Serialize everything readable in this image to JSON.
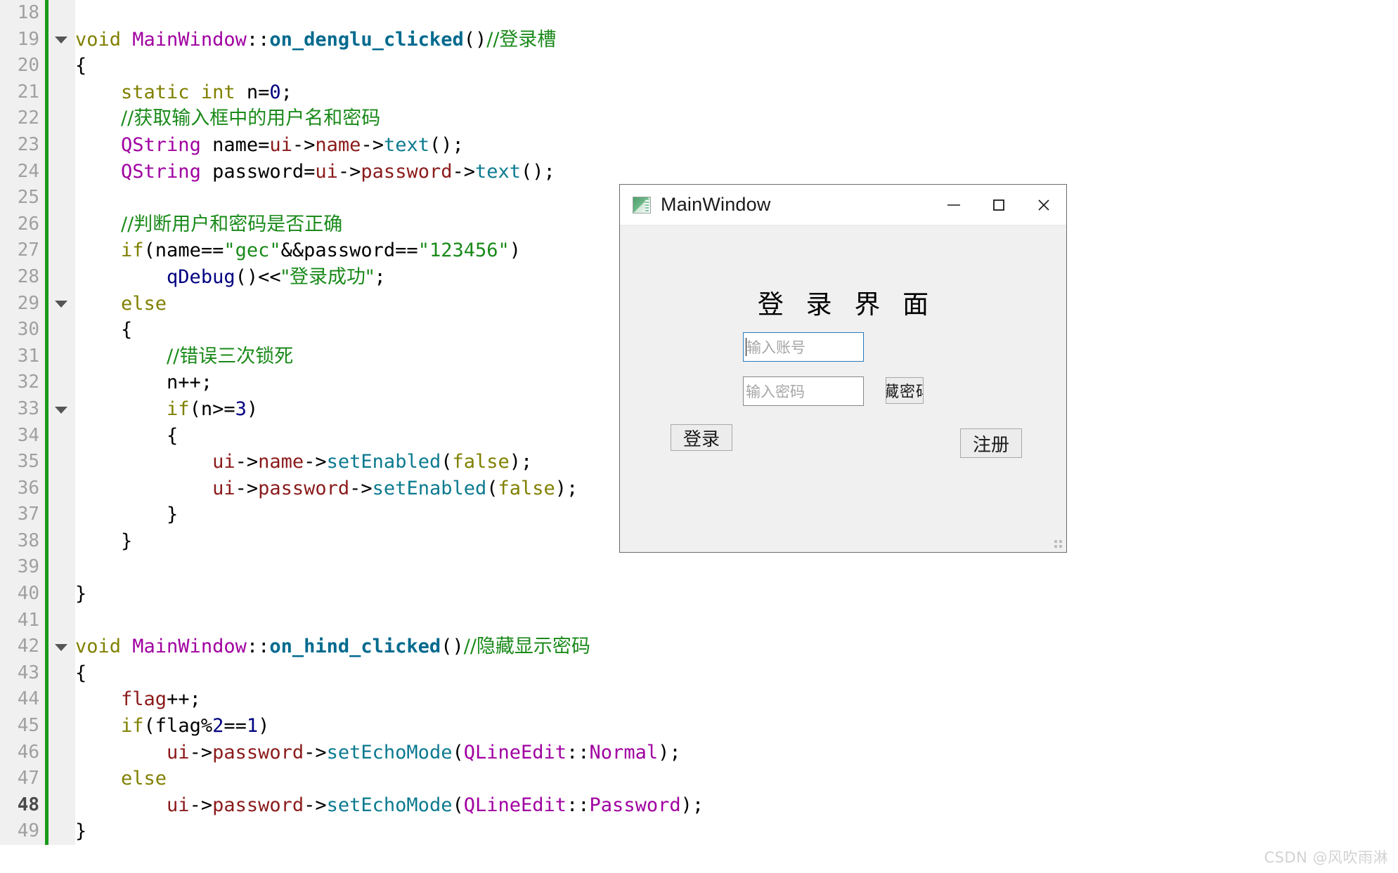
{
  "editor": {
    "current_line": 48,
    "gutter_bg": "#f0f0f0",
    "marker_color": "#1a9a1a",
    "lines": [
      {
        "num": "18",
        "fold": false,
        "tokens": []
      },
      {
        "num": "19",
        "fold": true,
        "tokens": [
          {
            "t": "void ",
            "c": "kw"
          },
          {
            "t": "MainWindow",
            "c": "cls"
          },
          {
            "t": "::",
            "c": "pl"
          },
          {
            "t": "on_denglu_clicked",
            "c": "fn"
          },
          {
            "t": "()",
            "c": "pl"
          },
          {
            "t": "//登录槽",
            "c": "cmt cjk"
          }
        ]
      },
      {
        "num": "20",
        "fold": false,
        "tokens": [
          {
            "t": "{",
            "c": "pl"
          }
        ]
      },
      {
        "num": "21",
        "fold": false,
        "tokens": [
          {
            "t": "    ",
            "c": "pl"
          },
          {
            "t": "static int",
            "c": "kw"
          },
          {
            "t": " n=",
            "c": "pl"
          },
          {
            "t": "0",
            "c": "num"
          },
          {
            "t": ";",
            "c": "pl"
          }
        ]
      },
      {
        "num": "22",
        "fold": false,
        "tokens": [
          {
            "t": "    ",
            "c": "pl"
          },
          {
            "t": "//获取输入框中的用户名和密码",
            "c": "cmt cjk"
          }
        ]
      },
      {
        "num": "23",
        "fold": false,
        "tokens": [
          {
            "t": "    ",
            "c": "pl"
          },
          {
            "t": "QString",
            "c": "cls"
          },
          {
            "t": " name=",
            "c": "pl"
          },
          {
            "t": "ui",
            "c": "mem"
          },
          {
            "t": "->",
            "c": "pl"
          },
          {
            "t": "name",
            "c": "mem"
          },
          {
            "t": "->",
            "c": "pl"
          },
          {
            "t": "text",
            "c": "mth"
          },
          {
            "t": "();",
            "c": "pl"
          }
        ]
      },
      {
        "num": "24",
        "fold": false,
        "tokens": [
          {
            "t": "    ",
            "c": "pl"
          },
          {
            "t": "QString",
            "c": "cls"
          },
          {
            "t": " password=",
            "c": "pl"
          },
          {
            "t": "ui",
            "c": "mem"
          },
          {
            "t": "->",
            "c": "pl"
          },
          {
            "t": "password",
            "c": "mem"
          },
          {
            "t": "->",
            "c": "pl"
          },
          {
            "t": "text",
            "c": "mth"
          },
          {
            "t": "();",
            "c": "pl"
          }
        ]
      },
      {
        "num": "25",
        "fold": false,
        "tokens": []
      },
      {
        "num": "26",
        "fold": false,
        "tokens": [
          {
            "t": "    ",
            "c": "pl"
          },
          {
            "t": "//判断用户和密码是否正确",
            "c": "cmt cjk"
          }
        ]
      },
      {
        "num": "27",
        "fold": false,
        "tokens": [
          {
            "t": "    ",
            "c": "pl"
          },
          {
            "t": "if",
            "c": "kw"
          },
          {
            "t": "(name==",
            "c": "pl"
          },
          {
            "t": "\"gec\"",
            "c": "str"
          },
          {
            "t": "&&password==",
            "c": "pl"
          },
          {
            "t": "\"123456\"",
            "c": "str"
          },
          {
            "t": ")",
            "c": "pl"
          }
        ]
      },
      {
        "num": "28",
        "fold": false,
        "tokens": [
          {
            "t": "        ",
            "c": "pl"
          },
          {
            "t": "qDebug",
            "c": "qdbg"
          },
          {
            "t": "()<<",
            "c": "pl"
          },
          {
            "t": "\"登录成功\"",
            "c": "str cjk"
          },
          {
            "t": ";",
            "c": "pl"
          }
        ]
      },
      {
        "num": "29",
        "fold": true,
        "tokens": [
          {
            "t": "    ",
            "c": "pl"
          },
          {
            "t": "else",
            "c": "kw"
          }
        ]
      },
      {
        "num": "30",
        "fold": false,
        "tokens": [
          {
            "t": "    {",
            "c": "pl"
          }
        ]
      },
      {
        "num": "31",
        "fold": false,
        "tokens": [
          {
            "t": "        ",
            "c": "pl"
          },
          {
            "t": "//错误三次锁死",
            "c": "cmt cjk"
          }
        ]
      },
      {
        "num": "32",
        "fold": false,
        "tokens": [
          {
            "t": "        ",
            "c": "pl"
          },
          {
            "t": "n++;",
            "c": "pl"
          }
        ]
      },
      {
        "num": "33",
        "fold": true,
        "tokens": [
          {
            "t": "        ",
            "c": "pl"
          },
          {
            "t": "if",
            "c": "kw"
          },
          {
            "t": "(n>=",
            "c": "pl"
          },
          {
            "t": "3",
            "c": "num"
          },
          {
            "t": ")",
            "c": "pl"
          }
        ]
      },
      {
        "num": "34",
        "fold": false,
        "tokens": [
          {
            "t": "        {",
            "c": "pl"
          }
        ]
      },
      {
        "num": "35",
        "fold": false,
        "tokens": [
          {
            "t": "            ",
            "c": "pl"
          },
          {
            "t": "ui",
            "c": "mem"
          },
          {
            "t": "->",
            "c": "pl"
          },
          {
            "t": "name",
            "c": "mem"
          },
          {
            "t": "->",
            "c": "pl"
          },
          {
            "t": "setEnabled",
            "c": "mth"
          },
          {
            "t": "(",
            "c": "pl"
          },
          {
            "t": "false",
            "c": "kw"
          },
          {
            "t": ");",
            "c": "pl"
          }
        ]
      },
      {
        "num": "36",
        "fold": false,
        "tokens": [
          {
            "t": "            ",
            "c": "pl"
          },
          {
            "t": "ui",
            "c": "mem"
          },
          {
            "t": "->",
            "c": "pl"
          },
          {
            "t": "password",
            "c": "mem"
          },
          {
            "t": "->",
            "c": "pl"
          },
          {
            "t": "setEnabled",
            "c": "mth"
          },
          {
            "t": "(",
            "c": "pl"
          },
          {
            "t": "false",
            "c": "kw"
          },
          {
            "t": ");",
            "c": "pl"
          }
        ]
      },
      {
        "num": "37",
        "fold": false,
        "tokens": [
          {
            "t": "        }",
            "c": "pl"
          }
        ]
      },
      {
        "num": "38",
        "fold": false,
        "tokens": [
          {
            "t": "    }",
            "c": "pl"
          }
        ]
      },
      {
        "num": "39",
        "fold": false,
        "tokens": []
      },
      {
        "num": "40",
        "fold": false,
        "tokens": [
          {
            "t": "}",
            "c": "pl"
          }
        ]
      },
      {
        "num": "41",
        "fold": false,
        "tokens": []
      },
      {
        "num": "42",
        "fold": true,
        "tokens": [
          {
            "t": "void ",
            "c": "kw"
          },
          {
            "t": "MainWindow",
            "c": "cls"
          },
          {
            "t": "::",
            "c": "pl"
          },
          {
            "t": "on_hind_clicked",
            "c": "fn"
          },
          {
            "t": "()",
            "c": "pl"
          },
          {
            "t": "//隐藏显示密码",
            "c": "cmt cjk"
          }
        ]
      },
      {
        "num": "43",
        "fold": false,
        "tokens": [
          {
            "t": "{",
            "c": "pl"
          }
        ]
      },
      {
        "num": "44",
        "fold": false,
        "tokens": [
          {
            "t": "    ",
            "c": "pl"
          },
          {
            "t": "flag",
            "c": "mem"
          },
          {
            "t": "++;",
            "c": "pl"
          }
        ]
      },
      {
        "num": "45",
        "fold": false,
        "tokens": [
          {
            "t": "    ",
            "c": "pl"
          },
          {
            "t": "if",
            "c": "kw"
          },
          {
            "t": "(flag%",
            "c": "pl"
          },
          {
            "t": "2",
            "c": "num"
          },
          {
            "t": "==",
            "c": "pl"
          },
          {
            "t": "1",
            "c": "num"
          },
          {
            "t": ")",
            "c": "pl"
          }
        ]
      },
      {
        "num": "46",
        "fold": false,
        "tokens": [
          {
            "t": "        ",
            "c": "pl"
          },
          {
            "t": "ui",
            "c": "mem"
          },
          {
            "t": "->",
            "c": "pl"
          },
          {
            "t": "password",
            "c": "mem"
          },
          {
            "t": "->",
            "c": "pl"
          },
          {
            "t": "setEchoMode",
            "c": "mth"
          },
          {
            "t": "(",
            "c": "pl"
          },
          {
            "t": "QLineEdit",
            "c": "cls"
          },
          {
            "t": "::",
            "c": "pl"
          },
          {
            "t": "Normal",
            "c": "cls"
          },
          {
            "t": ");",
            "c": "pl"
          }
        ]
      },
      {
        "num": "47",
        "fold": false,
        "tokens": [
          {
            "t": "    ",
            "c": "pl"
          },
          {
            "t": "else",
            "c": "kw"
          }
        ]
      },
      {
        "num": "48",
        "fold": false,
        "tokens": [
          {
            "t": "        ",
            "c": "pl"
          },
          {
            "t": "ui",
            "c": "mem"
          },
          {
            "t": "->",
            "c": "pl"
          },
          {
            "t": "password",
            "c": "mem"
          },
          {
            "t": "->",
            "c": "pl"
          },
          {
            "t": "setEchoMode",
            "c": "mth"
          },
          {
            "t": "(",
            "c": "pl"
          },
          {
            "t": "QLineEdit",
            "c": "cls"
          },
          {
            "t": "::",
            "c": "pl"
          },
          {
            "t": "Password",
            "c": "cls"
          },
          {
            "t": ");",
            "c": "pl"
          }
        ]
      },
      {
        "num": "49",
        "fold": false,
        "tokens": [
          {
            "t": "}",
            "c": "pl"
          }
        ]
      }
    ]
  },
  "qt_window": {
    "title": "MainWindow",
    "icon": "qt-app-icon",
    "controls": {
      "minimize": "minimize-icon",
      "maximize": "maximize-icon",
      "close": "close-icon"
    },
    "form_title": "登 录 界 面",
    "name_input": {
      "placeholder": "输入账号",
      "value": "",
      "focused": true
    },
    "password_input": {
      "placeholder": "输入密码",
      "value": "",
      "focused": false
    },
    "hide_button": "隐藏密码",
    "login_button": "登录",
    "register_button": "注册",
    "accent_focus_color": "#2a7ab9"
  },
  "watermark": "CSDN @风吹雨淋"
}
